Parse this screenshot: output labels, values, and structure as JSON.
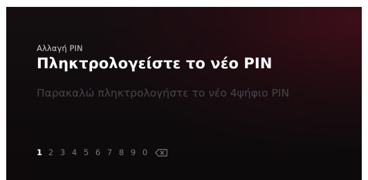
{
  "pin_change": {
    "subtitle": "Αλλαγή PIN",
    "title": "Πληκτρολογείστε το νέο PIN",
    "instruction": "Παρακαλώ πληκτρολογήστε το νέο 4ψήφιο PIN"
  },
  "keypad": {
    "selected_key": "1",
    "keys": [
      "1",
      "2",
      "3",
      "4",
      "5",
      "6",
      "7",
      "8",
      "9",
      "0"
    ],
    "backspace_icon": "backspace-icon"
  },
  "colors": {
    "background": "#0c0a0b",
    "accent_glow": "#5f0e20",
    "title": "#ffffff",
    "instruction": "#48444a",
    "key_inactive": "#7b7880",
    "key_active": "#ffffff"
  }
}
